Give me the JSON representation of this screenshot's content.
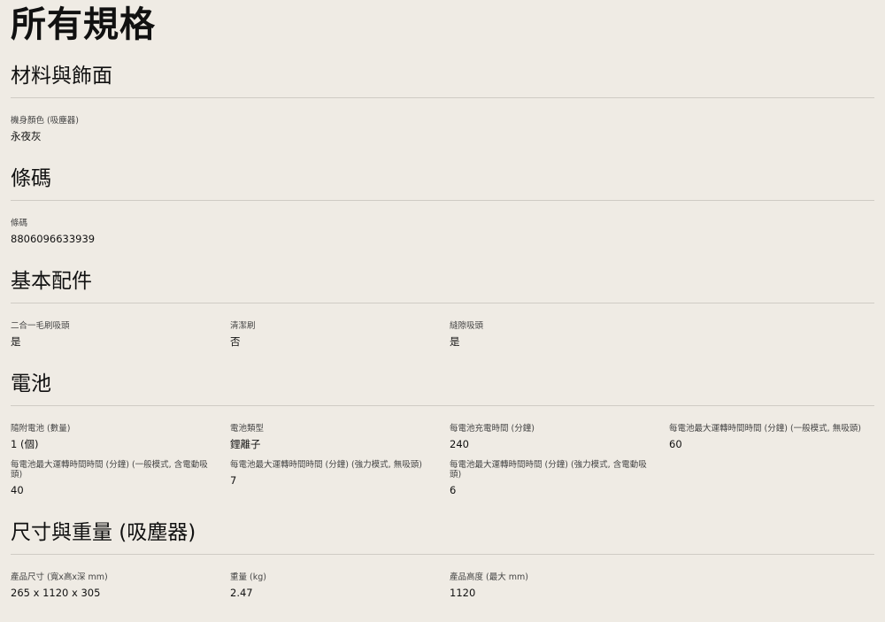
{
  "title": "所有規格",
  "sections": [
    {
      "heading": "材料與飾面",
      "items": [
        {
          "label": "機身顏色 (吸塵器)",
          "value": "永夜灰"
        }
      ]
    },
    {
      "heading": "條碼",
      "items": [
        {
          "label": "條碼",
          "value": "8806096633939"
        }
      ]
    },
    {
      "heading": "基本配件",
      "items": [
        {
          "label": "二合一毛刷吸頭",
          "value": "是"
        },
        {
          "label": "清潔刷",
          "value": "否"
        },
        {
          "label": "縫隙吸頭",
          "value": "是"
        }
      ]
    },
    {
      "heading": "電池",
      "items": [
        {
          "label": "隨附電池 (數量)",
          "value": "1 (個)"
        },
        {
          "label": "電池類型",
          "value": "鋰離子"
        },
        {
          "label": "每電池充電時間 (分鐘)",
          "value": "240"
        },
        {
          "label": "每電池最大運轉時間時間 (分鐘) (一般模式, 無吸頭)",
          "value": "60"
        },
        {
          "label": "每電池最大運轉時間時間 (分鐘) (一般模式, 含電動吸頭)",
          "value": "40"
        },
        {
          "label": "每電池最大運轉時間時間 (分鐘) (強力模式, 無吸頭)",
          "value": "7"
        },
        {
          "label": "每電池最大運轉時間時間 (分鐘) (強力模式, 含電動吸頭)",
          "value": "6"
        }
      ]
    },
    {
      "heading": "尺寸與重量 (吸塵器)",
      "items": [
        {
          "label": "產品尺寸 (寬x高x深 mm)",
          "value": "265 x 1120 x 305"
        },
        {
          "label": "重量 (kg)",
          "value": "2.47"
        },
        {
          "label": "產品高度 (最大 mm)",
          "value": "1120"
        }
      ]
    }
  ]
}
